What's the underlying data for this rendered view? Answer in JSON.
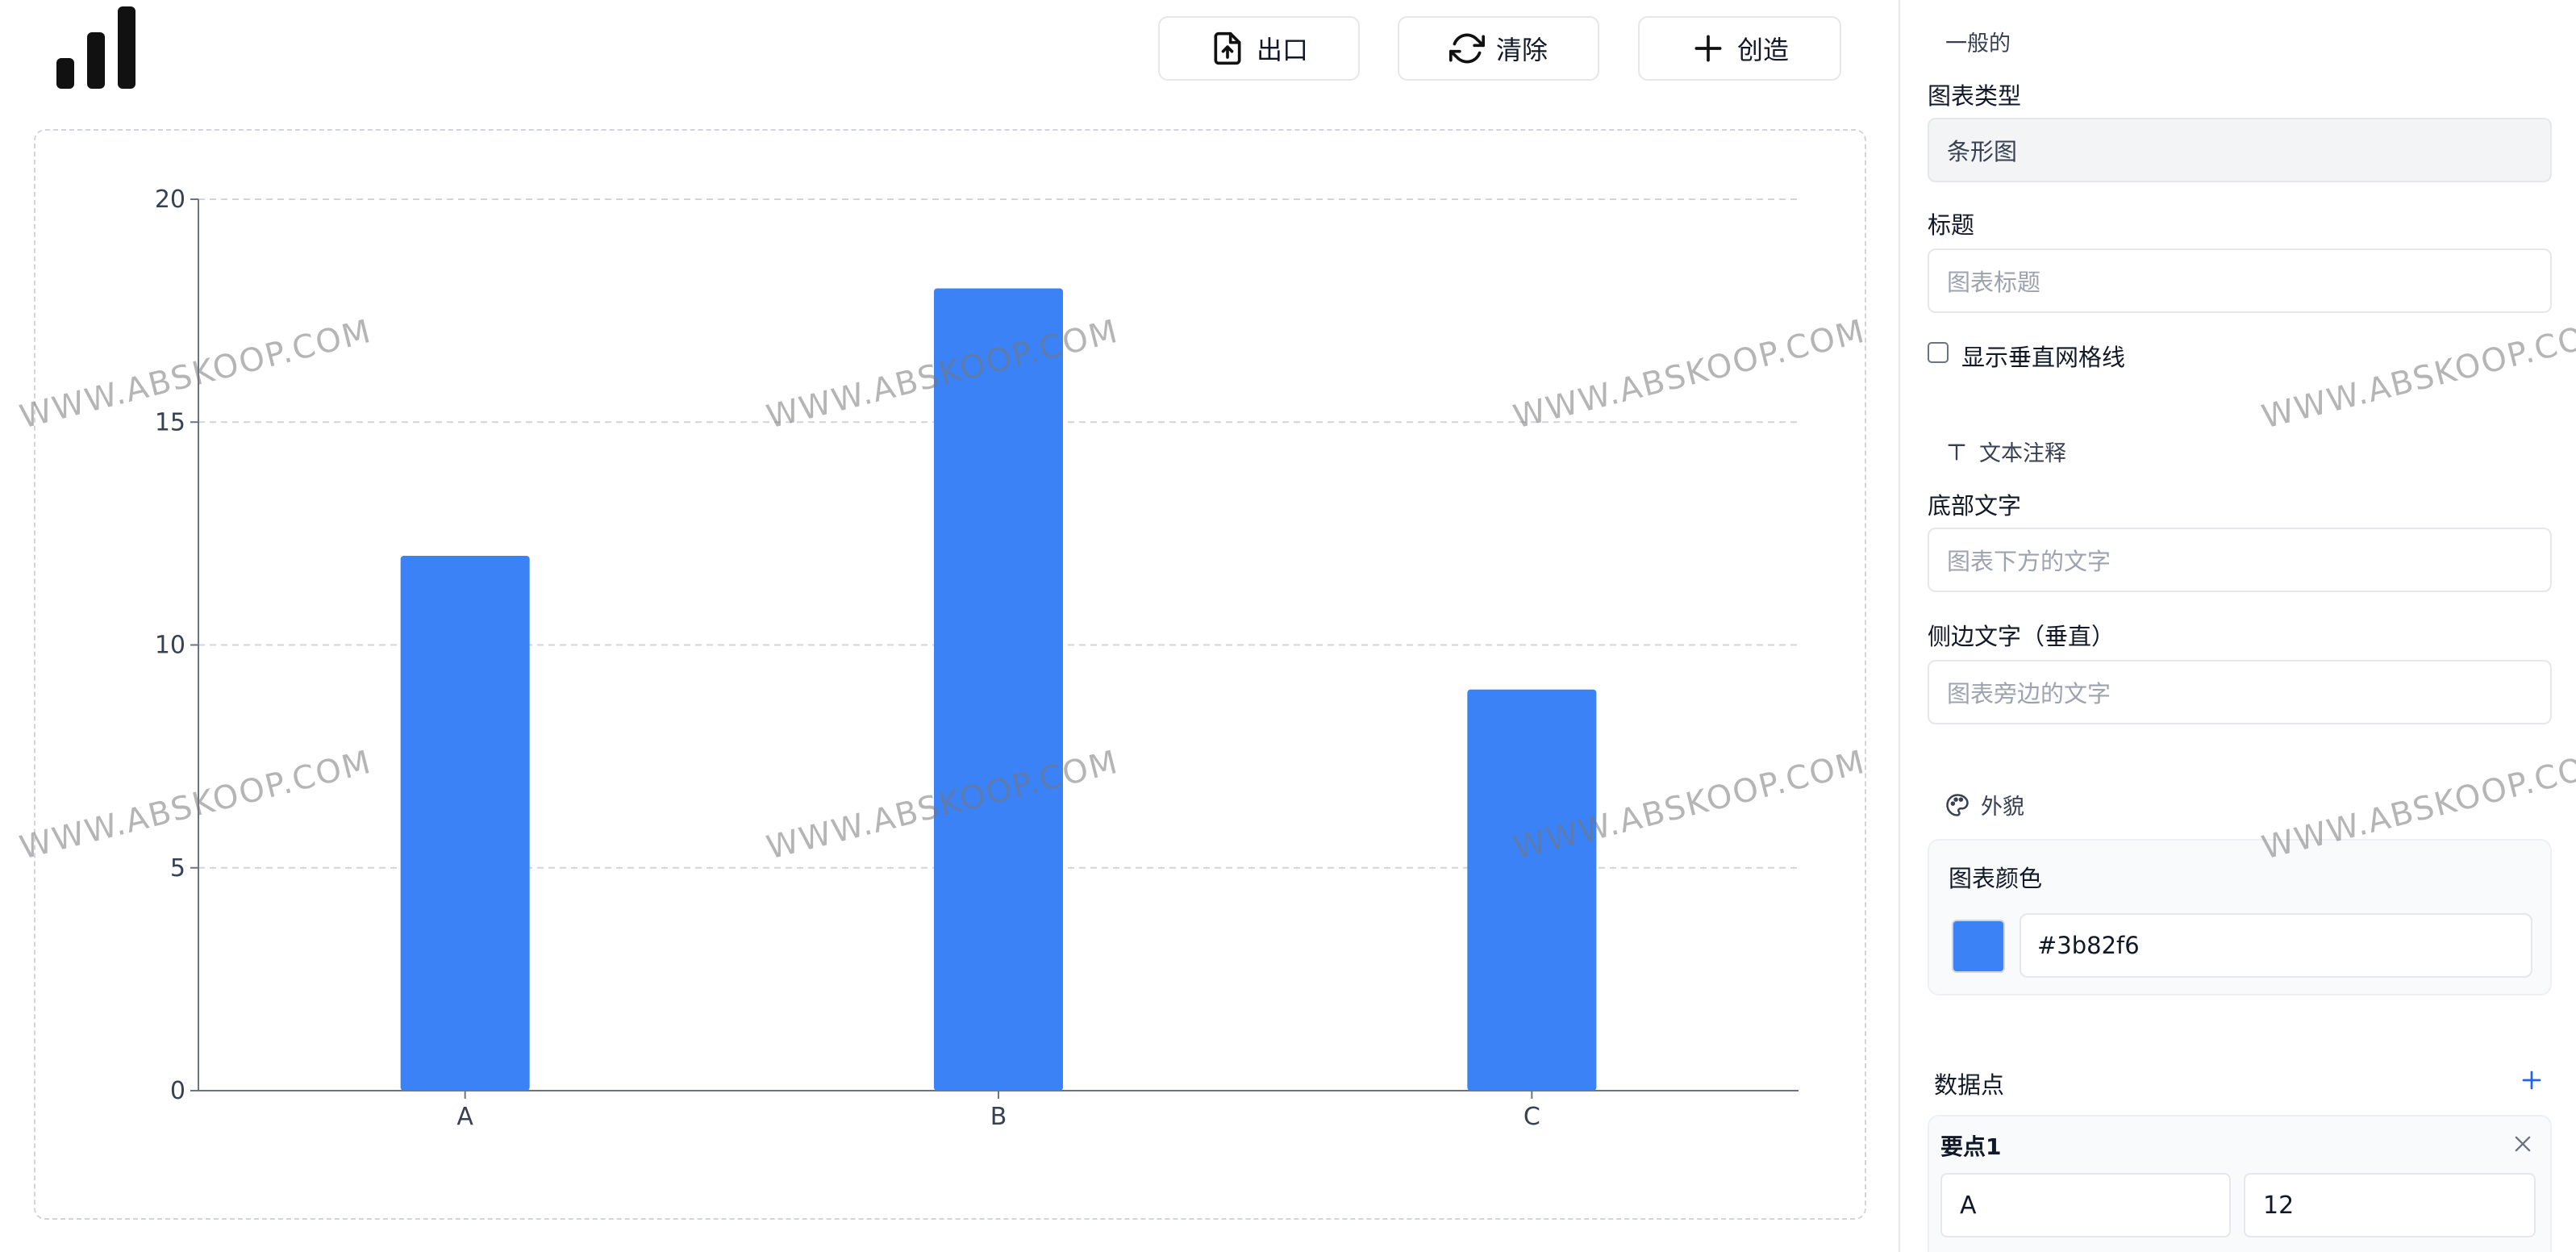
{
  "toolbar": {
    "export_label": "出口",
    "clear_label": "清除",
    "create_label": "创造"
  },
  "sidebar": {
    "general": {
      "heading": "一般的",
      "chart_type_label": "图表类型",
      "chart_type_value": "条形图",
      "title_label": "标题",
      "title_placeholder": "图表标题",
      "vertical_grid_label": "显示垂直网格线",
      "vertical_grid_checked": false
    },
    "annotations": {
      "heading": "文本注释",
      "bottom_label": "底部文字",
      "bottom_placeholder": "图表下方的文字",
      "side_label": "侧边文字（垂直）",
      "side_placeholder": "图表旁边的文字"
    },
    "appearance": {
      "heading": "外貌",
      "color_label": "图表颜色",
      "color_value": "#3b82f6"
    },
    "data_points": {
      "heading": "数据点",
      "items": [
        {
          "title": "要点1",
          "label": "A",
          "value": "12"
        }
      ]
    }
  },
  "watermark": "WWW.ABSKOOP.COM",
  "colors": {
    "accent": "#3b82f6",
    "add_icon": "#2563eb"
  },
  "chart_data": {
    "type": "bar",
    "categories": [
      "A",
      "B",
      "C"
    ],
    "values": [
      12,
      18,
      9
    ],
    "ylim": [
      0,
      20
    ],
    "yticks": [
      0,
      5,
      10,
      15,
      20
    ],
    "color": "#3b82f6",
    "grid": "horizontal",
    "title": "",
    "xlabel": "",
    "ylabel": ""
  }
}
